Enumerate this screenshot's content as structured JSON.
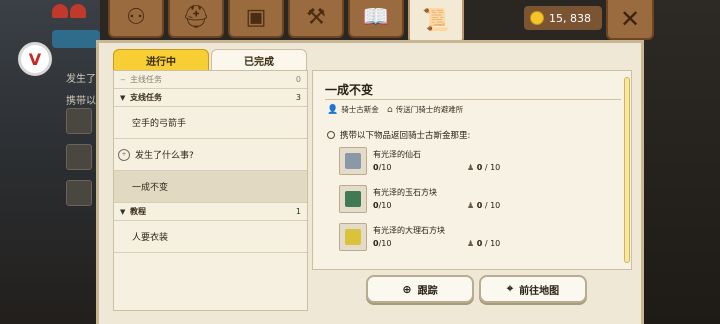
{
  "top_tabs": [
    {
      "icon": "hierarchy-icon",
      "glyph": "⚇"
    },
    {
      "icon": "helmet-icon",
      "glyph": "⛑"
    },
    {
      "icon": "chest-icon",
      "glyph": "▣"
    },
    {
      "icon": "hammer-icon",
      "glyph": "⚒"
    },
    {
      "icon": "book-icon",
      "glyph": "📖"
    },
    {
      "icon": "scroll-icon",
      "glyph": "📜"
    }
  ],
  "coins": "15, 838",
  "close_glyph": "✕",
  "sub_tabs": {
    "active": "进行中",
    "inactive": "已完成"
  },
  "categories": {
    "main": {
      "arrow": "−",
      "label": "主线任务",
      "count": "0"
    },
    "side": {
      "arrow": "▼",
      "label": "支线任务",
      "count": "3"
    },
    "tutorial": {
      "arrow": "▼",
      "label": "教程",
      "count": "1"
    }
  },
  "side_items": [
    "空手的弓箭手",
    "发生了什么事?",
    "一成不变"
  ],
  "tutorial_items": [
    "人要衣装"
  ],
  "detail": {
    "title": "一成不变",
    "giver": "骑士古斯金",
    "location": "传送门骑士的避难所",
    "description": "携带以下物品返回骑士古斯金那里:",
    "requirements": [
      {
        "name": "有光泽的仙石",
        "have": "0",
        "need": "/10",
        "bag": "0",
        "bag_need": "/ 10",
        "color": "#8a98a8"
      },
      {
        "name": "有光泽的玉石方块",
        "have": "0",
        "need": "/10",
        "bag": "0",
        "bag_need": "/ 10",
        "color": "#3f7a55"
      },
      {
        "name": "有光泽的大理石方块",
        "have": "0",
        "need": "/10",
        "bag": "0",
        "bag_need": "/ 10",
        "color": "#d8c33a"
      }
    ]
  },
  "buttons": {
    "track": "跟踪",
    "map": "前往地图"
  },
  "side_hud": {
    "text1": "发生了",
    "text2": "携带以"
  }
}
